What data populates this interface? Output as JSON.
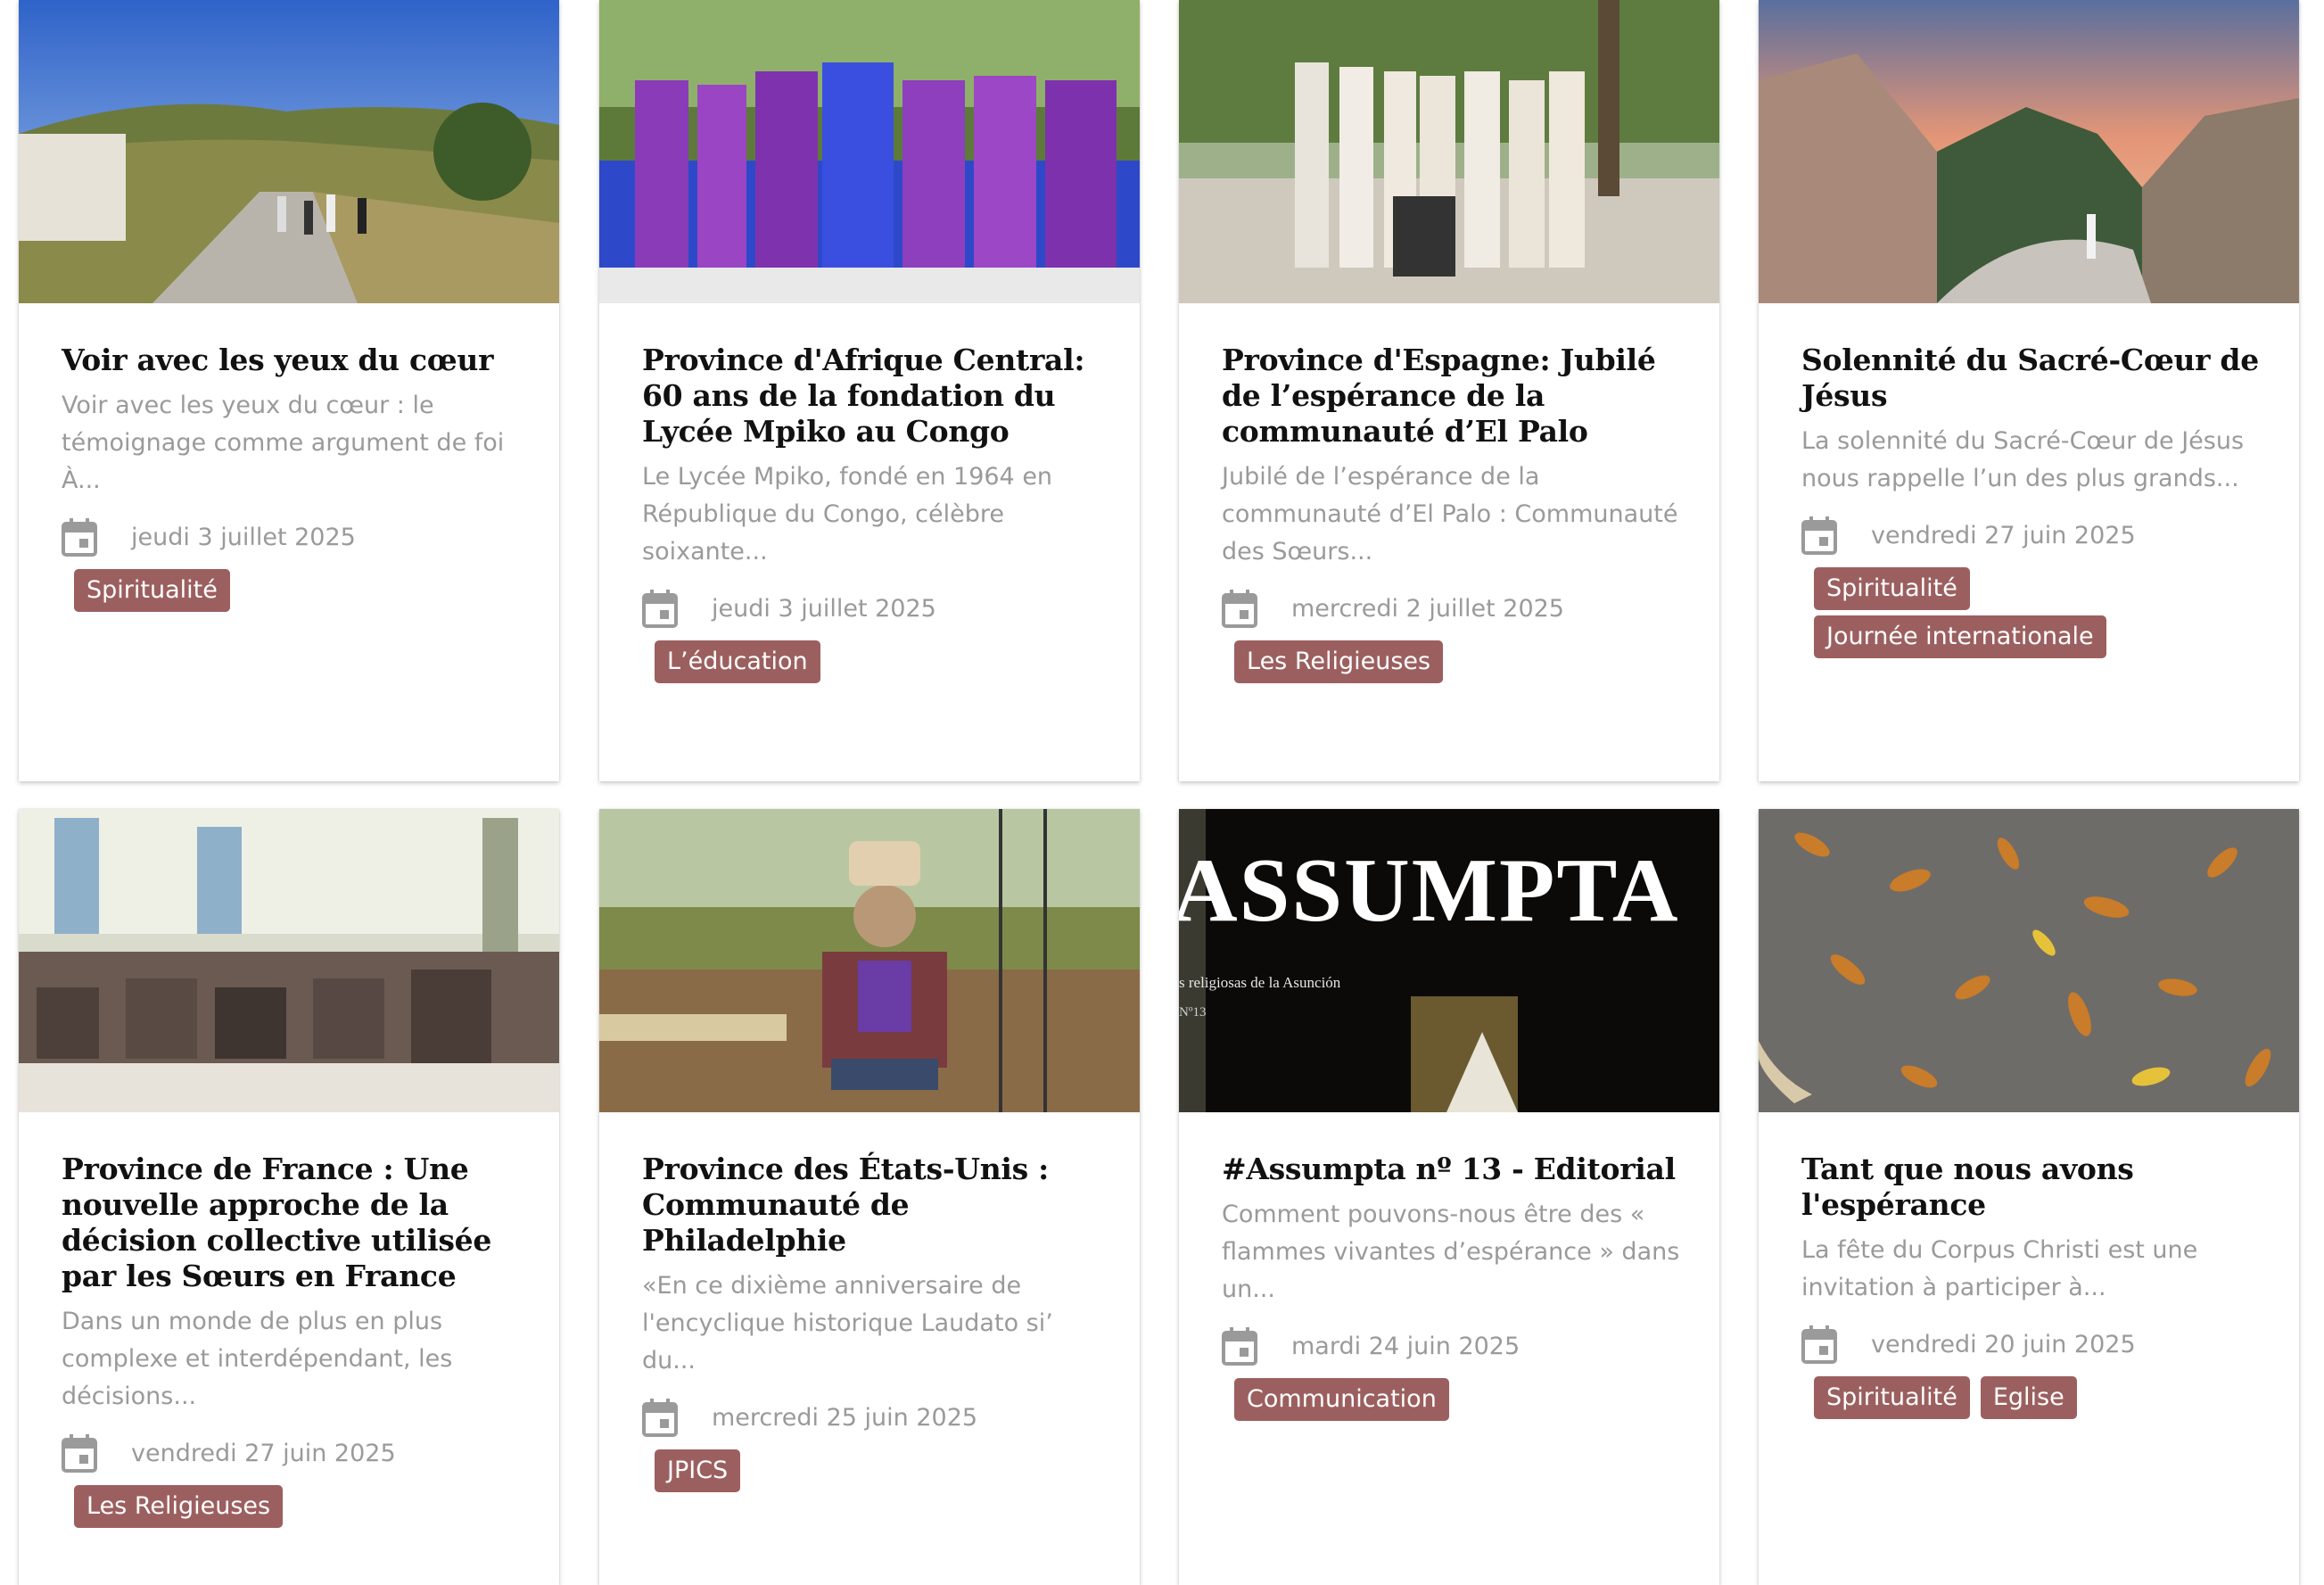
{
  "cards": [
    {
      "title": "Voir avec les yeux du cœur",
      "excerpt": "Voir avec les yeux du cœur : le témoignage comme argument de foi À...",
      "date": "jeudi 3 juillet 2025",
      "tags": [
        "Spiritualité"
      ],
      "image": "road-walkers-photo"
    },
    {
      "title": "Province d'Afrique Central: 60 ans de la fondation du Lycée Mpiko au Congo",
      "excerpt": "Le Lycée Mpiko, fondé en 1964 en République du Congo, célèbre soixante...",
      "date": "jeudi 3 juillet 2025",
      "tags": [
        "L’éducation"
      ],
      "image": "congo-celebration-photo"
    },
    {
      "title": "Province d'Espagne: Jubilé de l’espérance de la communauté d’El Palo",
      "excerpt": "Jubilé de l’espérance de la communauté d’El Palo : Communauté des Sœurs...",
      "date": "mercredi 2 juillet 2025",
      "tags": [
        "Les Religieuses"
      ],
      "image": "sisters-group-photo"
    },
    {
      "title": "Solennité du Sacré-Cœur de Jésus",
      "excerpt": "La solennité du Sacré-Cœur de Jésus nous rappelle l’un des plus grands...",
      "date": "vendredi 27 juin 2025",
      "tags": [
        "Spiritualité",
        "Journée internationale"
      ],
      "image": "mountain-sunset-photo"
    },
    {
      "title": "Province de France : Une nouvelle approche de la décision collective utilisée par les Sœurs en France",
      "excerpt": "Dans un monde de plus en plus complexe et interdépendant, les décisions...",
      "date": "vendredi 27 juin 2025",
      "tags": [
        "Les Religieuses"
      ],
      "image": "meeting-room-photo"
    },
    {
      "title": "Province des États-Unis : Communauté de Philadelphie",
      "excerpt": "«En ce dixième anniversaire de l'encyclique historique Laudato si’ du...",
      "date": "mercredi 25 juin 2025",
      "tags": [
        "JPICS"
      ],
      "image": "garden-photo"
    },
    {
      "title": "#Assumpta nº 13 - Editorial",
      "excerpt": "Comment pouvons-nous être des « flammes vivantes d’espérance » dans un...",
      "date": "mardi 24 juin 2025",
      "tags": [
        "Communication"
      ],
      "image": "assumpta-cover",
      "cover_title": "ASSUMPTA",
      "cover_subtitle": "s religiosas de la Asunción",
      "cover_issue": "Nº13"
    },
    {
      "title": "Tant que nous avons l'espérance",
      "excerpt": "La fête du Corpus Christi est une invitation à participer à...",
      "date": "vendredi 20 juin 2025",
      "tags": [
        "Spiritualité",
        "Eglise"
      ],
      "image": "autumn-leaves-photo"
    }
  ],
  "icons": {
    "date": "calendar-icon"
  },
  "colors": {
    "tag_background": "#9c5f5f",
    "title": "#111111",
    "muted_text": "#9a9a9a"
  }
}
